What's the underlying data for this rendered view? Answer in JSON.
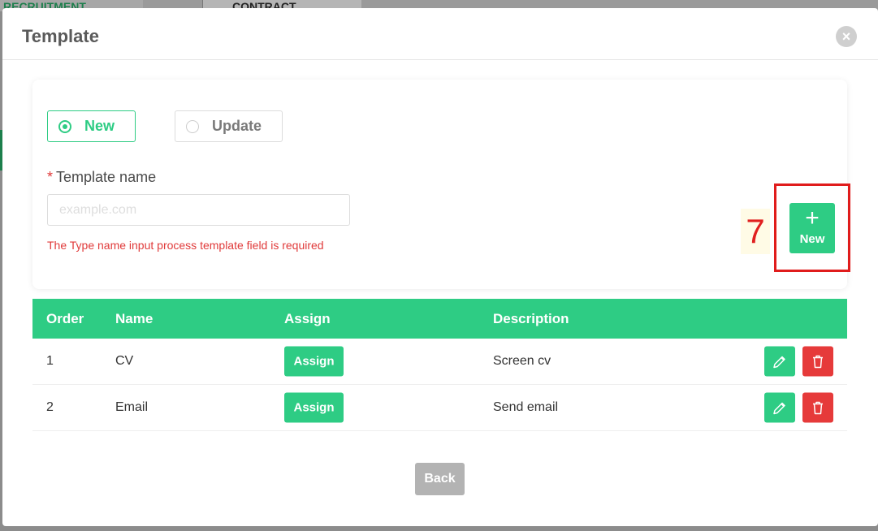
{
  "background": {
    "tab_recruitment": "RECRUITMENT",
    "tab_contract": "CONTRACT"
  },
  "modal": {
    "title": "Template"
  },
  "form": {
    "radio_new_label": "New",
    "radio_update_label": "Update",
    "selected": "New",
    "required_mark": "*",
    "field_label": "Template name",
    "input_value": "",
    "input_placeholder": "example.com",
    "error_message": "The Type name input process template field is required"
  },
  "annotation": {
    "step_number": "7"
  },
  "new_button": {
    "label": "New"
  },
  "table": {
    "headers": {
      "order": "Order",
      "name": "Name",
      "assign": "Assign",
      "description": "Description"
    },
    "rows": [
      {
        "order": "1",
        "name": "CV",
        "assign_label": "Assign",
        "description": "Screen cv"
      },
      {
        "order": "2",
        "name": "Email",
        "assign_label": "Assign",
        "description": "Send email"
      }
    ]
  },
  "footer": {
    "back_label": "Back"
  },
  "colors": {
    "accent": "#2ecc84",
    "danger": "#e63a3a",
    "annotation": "#e01c1c"
  }
}
